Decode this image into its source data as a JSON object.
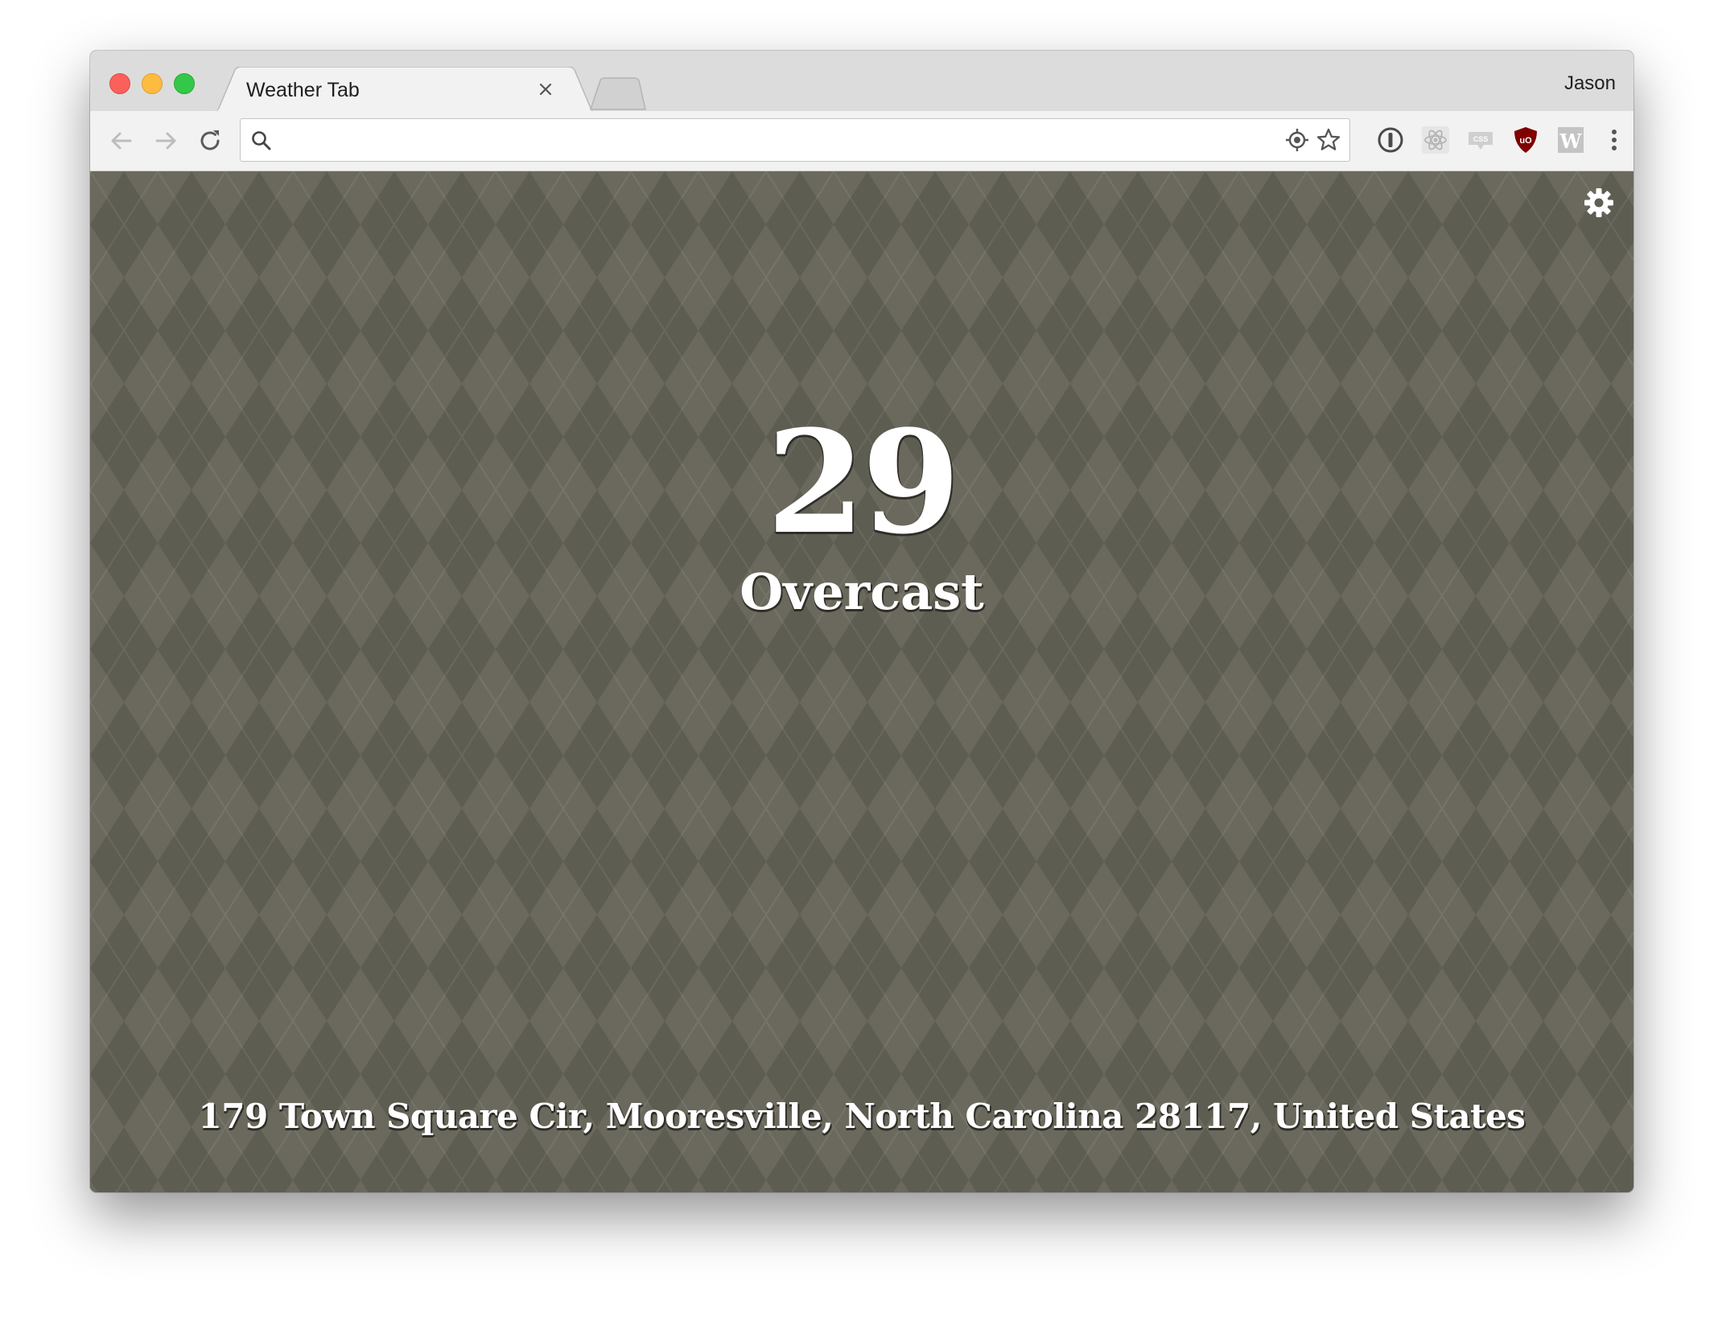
{
  "browser": {
    "tab_title": "Weather Tab",
    "profile_name": "Jason",
    "omnibox": {
      "value": "",
      "placeholder": ""
    },
    "extensions": [
      "1password-icon",
      "react-devtools-icon",
      "css-viewer-icon",
      "ublock-origin-icon",
      "w-extension-icon"
    ]
  },
  "weather": {
    "temperature": "29",
    "condition": "Overcast",
    "address": "179 Town Square Cir, Mooresville, North Carolina 28117, United States"
  },
  "colors": {
    "background": "#5f5e53",
    "text": "#ffffff"
  }
}
